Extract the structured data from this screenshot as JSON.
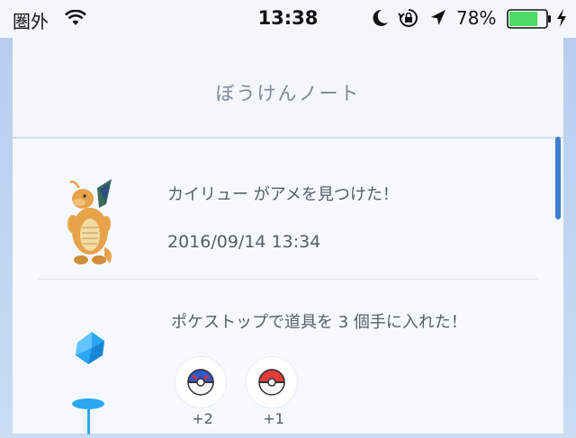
{
  "status": {
    "carrier": "圏外",
    "time": "13:38",
    "battery_percent": "78%",
    "battery_level": 0.78,
    "icons": [
      "wifi-icon",
      "moon-icon",
      "rotation-lock-icon",
      "location-icon",
      "battery-icon",
      "charging-icon"
    ]
  },
  "header": {
    "title": "ぼうけんノート"
  },
  "entries": [
    {
      "message": "カイリュー がアメを見つけた！",
      "timestamp": "2016/09/14 13:34",
      "image": "dragonite-image"
    },
    {
      "message": "ポケストップで道具を 3 個手に入れた！",
      "image": "pokestop-image",
      "items": [
        {
          "name": "great-ball-icon",
          "count": "+2"
        },
        {
          "name": "poke-ball-icon",
          "count": "+1"
        }
      ]
    }
  ],
  "colors": {
    "accent": "#3d7ed1",
    "battery": "#4cd964",
    "text": "#555f68"
  }
}
